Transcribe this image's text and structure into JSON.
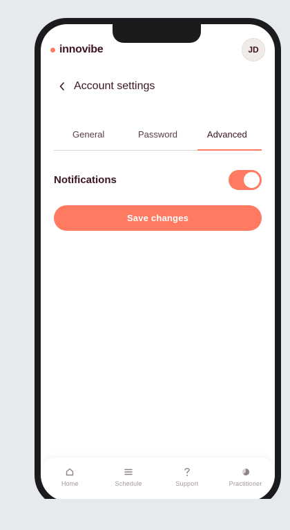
{
  "brand": {
    "name": "innovibe",
    "accent": "#ff7a61"
  },
  "user": {
    "initials": "JD"
  },
  "header": {
    "back_icon": "chevron-left-icon",
    "title": "Account settings"
  },
  "tabs": [
    {
      "label": "General",
      "active": false
    },
    {
      "label": "Password",
      "active": false
    },
    {
      "label": "Advanced",
      "active": true
    }
  ],
  "settings": {
    "notifications_label": "Notifications",
    "notifications_enabled": true
  },
  "actions": {
    "save_label": "Save changes"
  },
  "bottom_nav": [
    {
      "label": "Home",
      "icon": "home-icon"
    },
    {
      "label": "Schedule",
      "icon": "list-icon"
    },
    {
      "label": "Support",
      "icon": "question-icon"
    },
    {
      "label": "Practitioner",
      "icon": "pie-icon"
    }
  ],
  "colors": {
    "accent": "#ff7a61",
    "text_dark": "#3b1420",
    "background": "#e6e9ee"
  }
}
